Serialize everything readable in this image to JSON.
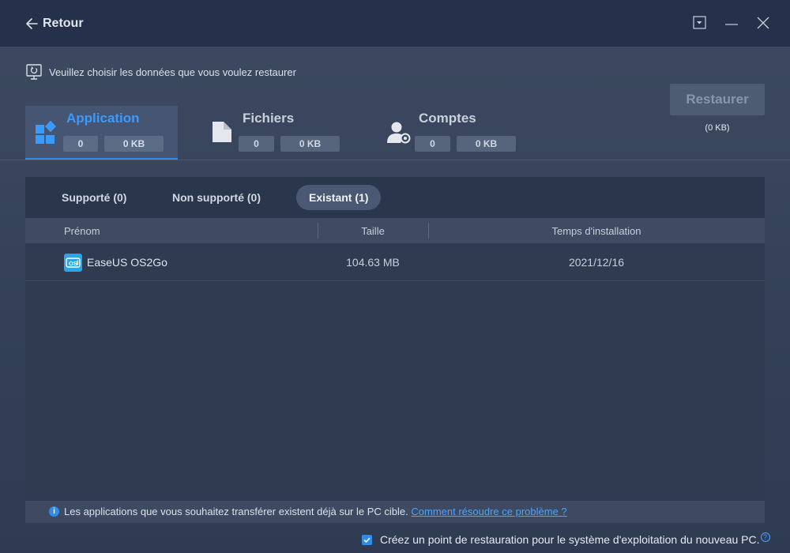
{
  "titlebar": {
    "back_label": "Retour",
    "icons": [
      "arrow-left-icon",
      "dropdown-menu-icon",
      "minimize-icon",
      "close-icon"
    ]
  },
  "hint": {
    "icon": "monitor-restore-icon",
    "text": "Veuillez choisir les données que vous voulez restaurer"
  },
  "tabs": [
    {
      "title": "Application",
      "count": "0",
      "size": "0 KB",
      "icon": "apps-grid-icon",
      "active": true
    },
    {
      "title": "Fichiers",
      "count": "0",
      "size": "0 KB",
      "icon": "file-icon",
      "active": false
    },
    {
      "title": "Comptes",
      "count": "0",
      "size": "0 KB",
      "icon": "user-gear-icon",
      "active": false
    }
  ],
  "restore": {
    "label": "Restaurer",
    "size": "(0 KB)",
    "enabled": false
  },
  "subtabs": [
    {
      "label": "Supporté (0)",
      "active": false
    },
    {
      "label": "Non supporté (0)",
      "active": false
    },
    {
      "label": "Existant (1)",
      "active": true
    }
  ],
  "table": {
    "columns": [
      "Prénom",
      "Taille",
      "Temps d'installation"
    ],
    "rows": [
      {
        "name": "EaseUS OS2Go",
        "icon": "os2go-app-icon",
        "icon_text": "OS",
        "size": "104.63 MB",
        "date": "2021/12/16"
      }
    ]
  },
  "info": {
    "text": "Les applications que vous souhaitez transférer existent déjà sur le PC cible.",
    "link": "Comment résoudre ce problème ?"
  },
  "footer": {
    "checkbox_checked": true,
    "text": "Créez un point de restauration pour le système d'exploitation du nouveau PC.",
    "help_glyph": "?"
  },
  "colors": {
    "accent": "#2f8bec",
    "link": "#4aa3ff",
    "titlebar": "#25314a",
    "background": "#3d4a61"
  }
}
